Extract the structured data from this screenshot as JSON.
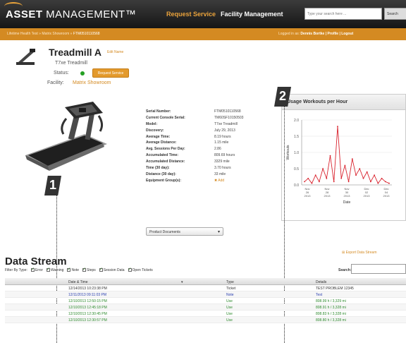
{
  "header": {
    "logo_bold": "ASSET",
    "logo_rest": " MANAGEMENT™",
    "nav_request": "Request Service",
    "nav_facility": "Facility Management",
    "search_placeholder": "Type your search here ...",
    "search_button": "Search"
  },
  "breadcrumb": {
    "path": "Lifetime Health Test » Matrix Showroom » ",
    "current": "FTM0510110568",
    "logged_in_label": "Logged in as: ",
    "logged_in_user": "Dennis Bortke | Profile | Logout"
  },
  "asset": {
    "title": "Treadmill A",
    "edit_label": "Edit Name",
    "subtitle": "T7xe Treadmill",
    "status_label": "Status:",
    "status_color": "#25a024",
    "request_button": "Request Service",
    "facility_label": "Facility:",
    "facility_value": "Matrix Showroom"
  },
  "details": [
    {
      "k": "Serial Number:",
      "v": "FTM0510110568"
    },
    {
      "k": "Current Console Serial:",
      "v": "TM60SF10150503"
    },
    {
      "k": "Model:",
      "v": "T7xe Treadmill"
    },
    {
      "k": "Discovery:",
      "v": "July 29, 2013"
    },
    {
      "k": "Average Time:",
      "v": "8.19 hours"
    },
    {
      "k": "Average Distance:",
      "v": "1.15 mile"
    },
    {
      "k": "Avg. Sessions Per Day:",
      "v": "2.86"
    },
    {
      "k": "Accumulated Time:",
      "v": "809.69 hours"
    },
    {
      "k": "Accumulated Distance:",
      "v": "3329 mile"
    },
    {
      "k": "Time (30 day):",
      "v": "3.70 hours"
    },
    {
      "k": "Distance (30 day):",
      "v": "33 mile"
    },
    {
      "k": "Equipment Group(s):",
      "v": "✖ Add",
      "link": true
    }
  ],
  "documents_select": "Product Documents",
  "chart_panel": {
    "title": "Usage Workouts per Hour"
  },
  "chart_data": {
    "type": "line",
    "title": "Usage Workouts per Hour",
    "xlabel": "Date",
    "ylabel": "Workouts",
    "ylim": [
      0,
      2.0
    ],
    "yticks": [
      "0.0",
      "0.5",
      "1.0",
      "1.5",
      "2.0"
    ],
    "xticks": [
      "Nov 26 2013",
      "Nov 28 2013",
      "Nov 30 2013",
      "Dec 02 2013",
      "Dec 04 2013"
    ],
    "series": [
      {
        "color": "#d9232e",
        "values": [
          0.1,
          0.2,
          0.05,
          0.3,
          0.1,
          0.5,
          0.2,
          0.9,
          0.1,
          1.8,
          0.2,
          0.6,
          0.1,
          0.8,
          0.3,
          0.5,
          0.2,
          0.4,
          0.1,
          0.3,
          0.05,
          0.2,
          0.1,
          0.05
        ]
      }
    ]
  },
  "callouts": [
    "1",
    "2"
  ],
  "data_stream": {
    "title": "Data Stream",
    "export_label": "Export Data Stream",
    "filter_label": "Filter By Type:",
    "filters": [
      "Error",
      "Warning",
      "Note",
      "Steps",
      "Session Data",
      "Open Tickets"
    ],
    "search_label": "Search:",
    "columns": [
      "Date & Time",
      "Type",
      "Details"
    ],
    "rows": [
      {
        "date": "12/14/2013 10:23:38 PM",
        "type": "Ticket",
        "details": "TEST PROBLEM 12345",
        "color": "#333333"
      },
      {
        "date": "12/11/2013 09:11:03 PM",
        "type": "Note",
        "details": "Test",
        "color": "#2a3fb0"
      },
      {
        "date": "12/10/2013 12:50:15 PM",
        "type": "Use",
        "details": "808.99 h / 3,329 mi",
        "color": "#2d8a2d"
      },
      {
        "date": "12/10/2013 12:45:18 PM",
        "type": "Use",
        "details": "808.91 h / 3,328 mi",
        "color": "#2d8a2d"
      },
      {
        "date": "12/10/2013 12:30:45 PM",
        "type": "Use",
        "details": "808.83 h / 3,328 mi",
        "color": "#2d8a2d"
      },
      {
        "date": "12/10/2013 12:30:57 PM",
        "type": "Use",
        "details": "808.80 h / 3,328 mi",
        "color": "#2d8a2d"
      }
    ]
  }
}
